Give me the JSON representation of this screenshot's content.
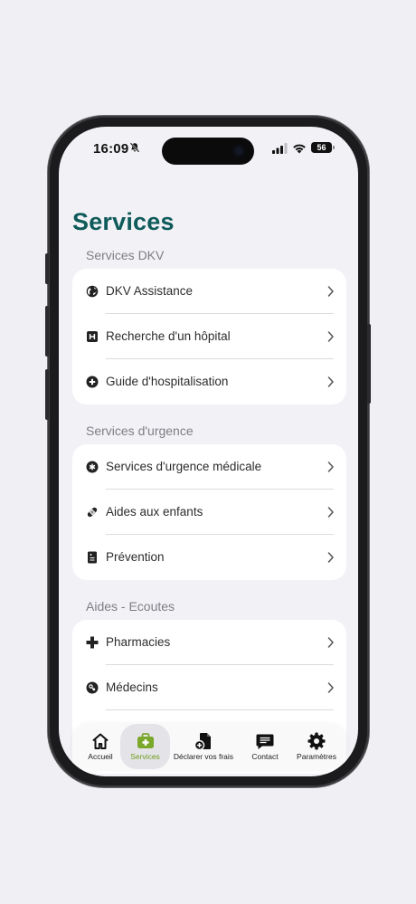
{
  "status_bar": {
    "time": "16:09",
    "battery": "56"
  },
  "page": {
    "title": "Services"
  },
  "sections": [
    {
      "header": "Services DKV",
      "items": [
        {
          "label": "DKV Assistance",
          "icon": "globe-icon"
        },
        {
          "label": "Recherche d'un hôpital",
          "icon": "hospital-icon"
        },
        {
          "label": "Guide d'hospitalisation",
          "icon": "plus-circle-icon"
        }
      ]
    },
    {
      "header": "Services d'urgence",
      "items": [
        {
          "label": "Services d'urgence médicale",
          "icon": "asterisk-circle-icon"
        },
        {
          "label": "Aides aux enfants",
          "icon": "bandage-icon"
        },
        {
          "label": "Prévention",
          "icon": "document-icon"
        }
      ]
    },
    {
      "header": "Aides - Ecoutes",
      "items": [
        {
          "label": "Pharmacies",
          "icon": "cross-icon"
        },
        {
          "label": "Médecins",
          "icon": "doctor-icon"
        }
      ]
    }
  ],
  "tab_bar": {
    "tabs": [
      {
        "label": "Accueil",
        "icon": "home-icon"
      },
      {
        "label": "Services",
        "icon": "medical-kit-icon",
        "active": true
      },
      {
        "label": "Déclarer vos frais",
        "icon": "add-document-icon"
      },
      {
        "label": "Contact",
        "icon": "chat-icon"
      },
      {
        "label": "Paramètres",
        "icon": "gear-icon"
      }
    ]
  },
  "colors": {
    "title": "#0f5a5a",
    "accent": "#7aa82a",
    "background": "#f2f2f6"
  }
}
